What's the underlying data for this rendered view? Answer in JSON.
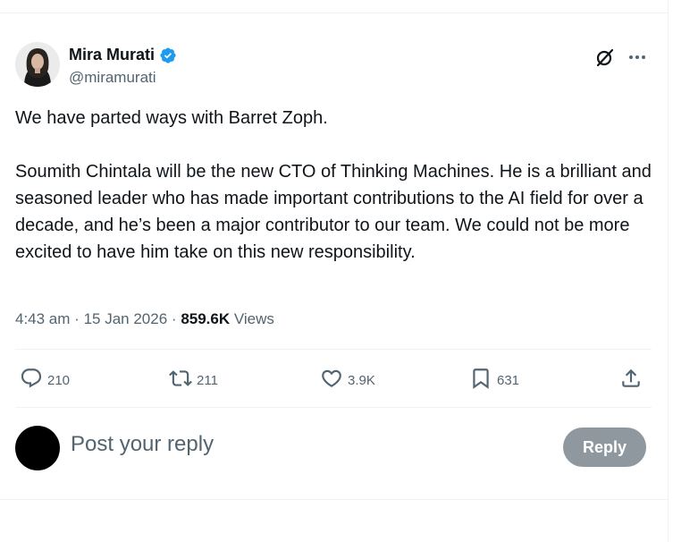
{
  "author": {
    "display_name": "Mira Murati",
    "handle": "@miramurati",
    "verified_icon": "verified-badge-icon",
    "verified_color": "#1d9bf0"
  },
  "tweet": {
    "paragraphs": [
      "We have parted ways with Barret Zoph.",
      "Soumith Chintala will be the new CTO of Thinking Machines. He is a brilliant and seasoned leader who has made important contributions to the AI field for over a decade, and he’s been a major contributor to our team. We could not be more excited to have him take on this new responsibility."
    ],
    "time": "4:43 am",
    "date": "15 Jan 2026",
    "separator": "·",
    "views_count": "859.6K",
    "views_label": "Views"
  },
  "actions": {
    "replies": "210",
    "reposts": "211",
    "likes": "3.9K",
    "bookmarks": "631"
  },
  "reply": {
    "placeholder": "Post your reply",
    "button_label": "Reply"
  },
  "colors": {
    "text": "#0f1419",
    "secondary": "#536471",
    "divider": "#eff3f4",
    "reply_button": "#8f989f"
  }
}
